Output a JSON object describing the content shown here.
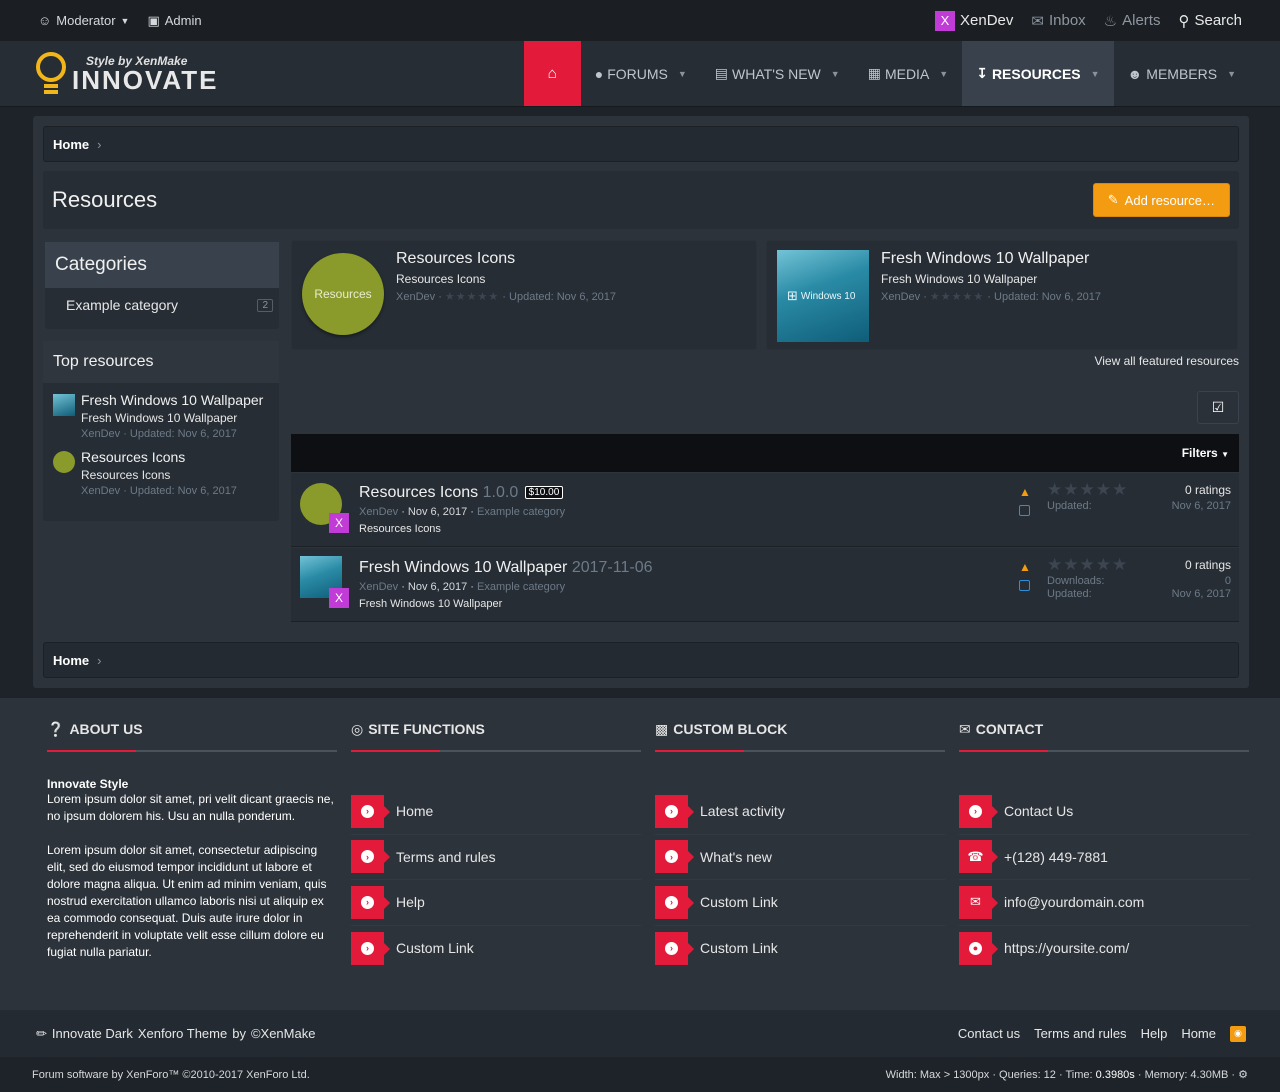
{
  "topbar": {
    "moderator": "Moderator",
    "admin": "Admin",
    "user": "XenDev",
    "user_badge": "X",
    "inbox": "Inbox",
    "alerts": "Alerts",
    "search": "Search"
  },
  "logo": {
    "tagline": "Style by XenMake",
    "name": "INNOVATE"
  },
  "nav": [
    {
      "label": "Forums"
    },
    {
      "label": "What's new"
    },
    {
      "label": "Media"
    },
    {
      "label": "Resources"
    },
    {
      "label": "Members"
    }
  ],
  "breadcrumb": {
    "home": "Home",
    "sep": "›"
  },
  "page": {
    "title": "Resources",
    "add_button": "Add resource…"
  },
  "categories": {
    "title": "Categories",
    "items": [
      {
        "label": "Example category",
        "count": "2"
      }
    ]
  },
  "top_resources": {
    "title": "Top resources",
    "items": [
      {
        "title": "Fresh Windows 10 Wallpaper",
        "subtitle": "Fresh Windows 10 Wallpaper",
        "meta": "XenDev · Updated: Nov 6, 2017"
      },
      {
        "title": "Resources Icons",
        "subtitle": "Resources Icons",
        "meta": "XenDev · Updated: Nov 6, 2017"
      }
    ]
  },
  "featured": [
    {
      "title": "Resources Icons",
      "subtitle": "Resources Icons",
      "author": "XenDev ·",
      "updated": "· Updated: Nov 6, 2017",
      "thumb_label": "Resources"
    },
    {
      "title": "Fresh Windows 10 Wallpaper",
      "subtitle": "Fresh Windows 10 Wallpaper",
      "author": "XenDev ·",
      "updated": "· Updated: Nov 6, 2017",
      "thumb_label": "Windows 10"
    }
  ],
  "view_all": "View all featured resources",
  "filters": "Filters",
  "resources": [
    {
      "title": "Resources Icons",
      "version": "1.0.0",
      "price": "$10.00",
      "author": "XenDev",
      "date": "· Nov 6, 2017 ·",
      "category": "Example category",
      "tagline": "Resources Icons",
      "ratings": "0 ratings",
      "stats": [
        {
          "label": "Updated:",
          "value": "Nov 6, 2017"
        }
      ]
    },
    {
      "title": "Fresh Windows 10 Wallpaper",
      "version": "2017-11-06",
      "price": "",
      "author": "XenDev",
      "date": "· Nov 6, 2017 ·",
      "category": "Example category",
      "tagline": "Fresh Windows 10 Wallpaper",
      "ratings": "0 ratings",
      "stats": [
        {
          "label": "Downloads:",
          "value": "0"
        },
        {
          "label": "Updated:",
          "value": "Nov 6, 2017"
        }
      ]
    }
  ],
  "footer": {
    "about": {
      "title": "About us",
      "name": "Innovate Style",
      "p1": "Lorem ipsum dolor sit amet, pri velit dicant graecis ne, no ipsum dolorem his. Usu an nulla ponderum.",
      "p2": "Lorem ipsum dolor sit amet, consectetur adipiscing elit, sed do eiusmod tempor incididunt ut labore et dolore magna aliqua. Ut enim ad minim veniam, quis nostrud exercitation ullamco laboris nisi ut aliquip ex ea commodo consequat. Duis aute irure dolor in reprehenderit in voluptate velit esse cillum dolore eu fugiat nulla pariatur."
    },
    "site_functions": {
      "title": "Site functions",
      "links": [
        "Home",
        "Terms and rules",
        "Help",
        "Custom Link"
      ]
    },
    "custom_block": {
      "title": "Custom block",
      "links": [
        "Latest activity",
        "What's new",
        "Custom Link",
        "Custom Link"
      ]
    },
    "contact": {
      "title": "Contact",
      "links": [
        "Contact Us",
        "+(128) 449-7881",
        "info@yourdomain.com",
        "https://yoursite.com/"
      ]
    }
  },
  "footbar": {
    "credit": [
      "Innovate Dark",
      "Xenforo Theme",
      "by",
      "©XenMake"
    ],
    "links": [
      "Contact us",
      "Terms and rules",
      "Help",
      "Home"
    ]
  },
  "copyright": {
    "left": "Forum software by XenForo™ ©2010-2017 XenForo Ltd.",
    "stats_a": "Width: Max > 1300px · Queries: 12 · Time:",
    "time": "0.3980s",
    "stats_b": "· Memory: 4.30MB ·"
  },
  "colors": {
    "accent": "#e41a3a",
    "button": "#f39c12",
    "user_badge": "#c13bd6"
  }
}
